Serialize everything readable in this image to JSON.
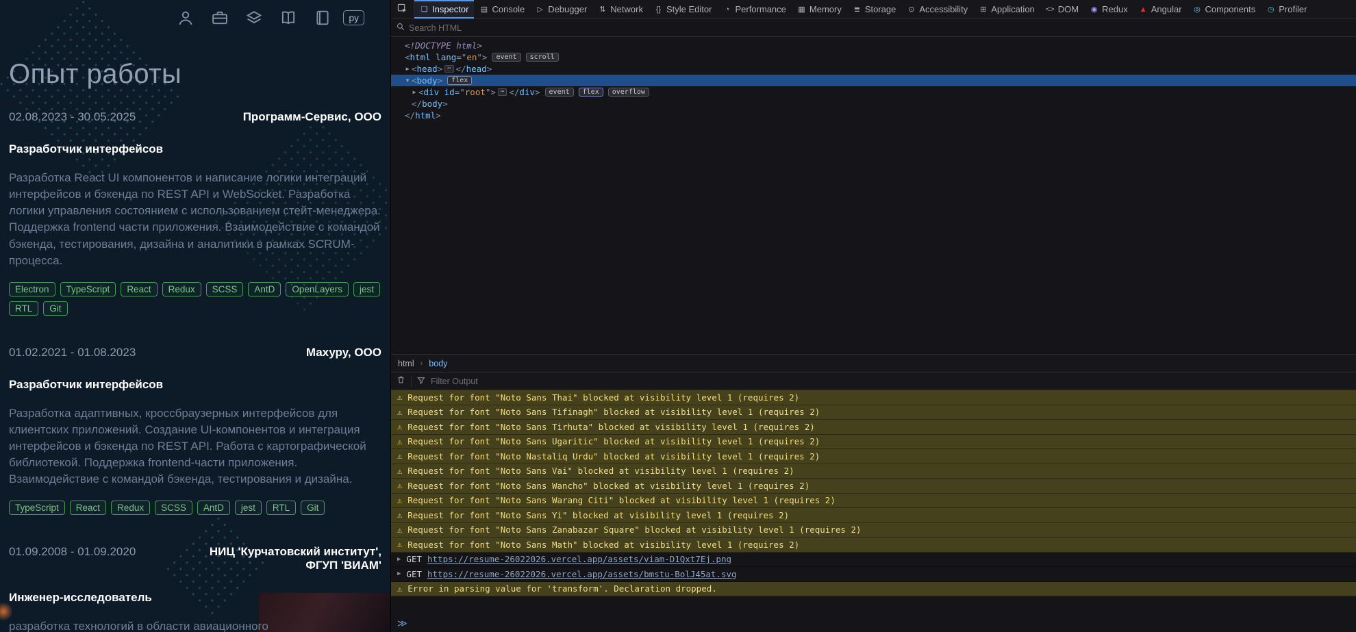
{
  "colors": {
    "site_bg": "#0d1a27",
    "tag_green_border": "#3f9d54",
    "devtools_selection": "#204e8a",
    "warning_bg": "#45411d",
    "warning_text": "#f2dd82",
    "markup_tag_blue": "#75bfff",
    "markup_value_orange": "#d2985f"
  },
  "site": {
    "header": {
      "icons": [
        "user-icon",
        "briefcase-icon",
        "layers-icon",
        "library-icon",
        "book-icon"
      ],
      "lang_label": "ру"
    },
    "page_title": "Опыт работы",
    "jobs": [
      {
        "period": "02.08.2023 - 30.05.2025",
        "company": "Программ-Сервис, ООО",
        "role": "Разработчик интерфейсов",
        "description": "Разработка React UI компонентов и написание логики интеграций интерфейсов и бэкенда по REST API и WebSocket. Разработка логики управления состоянием с использованием стейт-менеджера. Поддержка frontend части приложения. Взаимодействие с командой бэкенда, тестирования, дизайна и аналитики в рамках SCRUM-процесса.",
        "tags": [
          "Electron",
          "TypeScript",
          "React",
          "Redux",
          "SCSS",
          "AntD",
          "OpenLayers",
          "jest",
          "RTL",
          "Git"
        ]
      },
      {
        "period": "01.02.2021 - 01.08.2023",
        "company": "Махуру, ООО",
        "role": "Разработчик интерфейсов",
        "description": "Разработка адаптивных, кроссбраузерных интерфейсов для клиентских приложений. Создание UI-компонентов и интеграция интерфейсов и бэкенда по REST API. Работа с картографической библиотекой. Поддержка frontend-части приложения. Взаимодействие с командой бэкенда, тестирования и дизайна.",
        "tags": [
          "TypeScript",
          "React",
          "Redux",
          "SCSS",
          "AntD",
          "jest",
          "RTL",
          "Git"
        ]
      },
      {
        "period": "01.09.2008 - 01.09.2020",
        "company": "НИЦ 'Курчатовский институт',\nФГУП 'ВИАМ'",
        "role": "Инженер-исследователь",
        "description": "разработка технологий в области авиационного",
        "tags": []
      }
    ]
  },
  "devtools": {
    "tabs": [
      {
        "label": "Inspector",
        "icon": "inspector-icon",
        "selected": true
      },
      {
        "label": "Console",
        "icon": "console-icon",
        "selected": false
      },
      {
        "label": "Debugger",
        "icon": "debugger-icon",
        "selected": false
      },
      {
        "label": "Network",
        "icon": "network-icon",
        "selected": false
      },
      {
        "label": "Style Editor",
        "icon": "style-editor-icon",
        "selected": false
      },
      {
        "label": "Performance",
        "icon": "performance-icon",
        "selected": false
      },
      {
        "label": "Memory",
        "icon": "memory-icon",
        "selected": false
      },
      {
        "label": "Storage",
        "icon": "storage-icon",
        "selected": false
      },
      {
        "label": "Accessibility",
        "icon": "accessibility-icon",
        "selected": false
      },
      {
        "label": "Application",
        "icon": "application-icon",
        "selected": false
      },
      {
        "label": "DOM",
        "icon": "dom-icon",
        "selected": false
      },
      {
        "label": "Redux",
        "icon": "redux-icon",
        "selected": false
      },
      {
        "label": "Angular",
        "icon": "angular-icon",
        "selected": false
      },
      {
        "label": "Components",
        "icon": "components-icon",
        "selected": false
      },
      {
        "label": "Profiler",
        "icon": "profiler-icon",
        "selected": false
      }
    ],
    "search_placeholder": "Search HTML",
    "markup_lines": [
      {
        "indent": 0,
        "arrow": null,
        "selected": false,
        "tokens": [
          [
            "doctype",
            "<!DOCTYPE html>"
          ]
        ]
      },
      {
        "indent": 0,
        "arrow": null,
        "selected": false,
        "tokens": [
          [
            "punc",
            "<"
          ],
          [
            "tag",
            "html"
          ],
          [
            "punc",
            " "
          ],
          [
            "attr",
            "lang"
          ],
          [
            "punc",
            "=\""
          ],
          [
            "val",
            "en"
          ],
          [
            "punc",
            "\">"
          ],
          [
            "badge",
            "event"
          ],
          [
            "badge",
            "scroll"
          ]
        ]
      },
      {
        "indent": 1,
        "arrow": "collapsed",
        "selected": false,
        "tokens": [
          [
            "punc",
            "<"
          ],
          [
            "tag",
            "head"
          ],
          [
            "punc",
            ">"
          ],
          [
            "ellipsis",
            "⋯"
          ],
          [
            "punc",
            "</"
          ],
          [
            "tag",
            "head"
          ],
          [
            "punc",
            ">"
          ]
        ]
      },
      {
        "indent": 1,
        "arrow": "expanded",
        "selected": true,
        "tokens": [
          [
            "punc",
            "<"
          ],
          [
            "tag",
            "body"
          ],
          [
            "punc",
            ">"
          ],
          [
            "badgeflex",
            "flex"
          ]
        ]
      },
      {
        "indent": 2,
        "arrow": "collapsed",
        "selected": false,
        "tokens": [
          [
            "punc",
            "<"
          ],
          [
            "tag",
            "div"
          ],
          [
            "punc",
            " "
          ],
          [
            "attr",
            "id"
          ],
          [
            "punc",
            "=\""
          ],
          [
            "val",
            "root"
          ],
          [
            "punc",
            "\">"
          ],
          [
            "ellipsis",
            "⋯"
          ],
          [
            "punc",
            "</"
          ],
          [
            "tag",
            "div"
          ],
          [
            "punc",
            ">"
          ],
          [
            "badge",
            "event"
          ],
          [
            "badgeflex",
            "flex"
          ],
          [
            "badge",
            "overflow"
          ]
        ]
      },
      {
        "indent": 1,
        "arrow": null,
        "selected": false,
        "tokens": [
          [
            "punc",
            "</"
          ],
          [
            "tag",
            "body"
          ],
          [
            "punc",
            ">"
          ]
        ]
      },
      {
        "indent": 0,
        "arrow": null,
        "selected": false,
        "tokens": [
          [
            "punc",
            "</"
          ],
          [
            "tag",
            "html"
          ],
          [
            "punc",
            ">"
          ]
        ]
      }
    ],
    "breadcrumbs": [
      {
        "label": "html",
        "selected": false
      },
      {
        "label": "body",
        "selected": true
      }
    ],
    "console": {
      "filter_placeholder": "Filter Output",
      "prompt": "≫",
      "rows": [
        {
          "type": "warn",
          "text": "Request for font \"Noto Sans Thai\" blocked at visibility level 1 (requires 2)"
        },
        {
          "type": "warn",
          "text": "Request for font \"Noto Sans Tifinagh\" blocked at visibility level 1 (requires 2)"
        },
        {
          "type": "warn",
          "text": "Request for font \"Noto Sans Tirhuta\" blocked at visibility level 1 (requires 2)"
        },
        {
          "type": "warn",
          "text": "Request for font \"Noto Sans Ugaritic\" blocked at visibility level 1 (requires 2)"
        },
        {
          "type": "warn",
          "text": "Request for font \"Noto Nastaliq Urdu\" blocked at visibility level 1 (requires 2)"
        },
        {
          "type": "warn",
          "text": "Request for font \"Noto Sans Vai\" blocked at visibility level 1 (requires 2)"
        },
        {
          "type": "warn",
          "text": "Request for font \"Noto Sans Wancho\" blocked at visibility level 1 (requires 2)"
        },
        {
          "type": "warn",
          "text": "Request for font \"Noto Sans Warang Citi\" blocked at visibility level 1 (requires 2)"
        },
        {
          "type": "warn",
          "text": "Request for font \"Noto Sans Yi\" blocked at visibility level 1 (requires 2)"
        },
        {
          "type": "warn",
          "text": "Request for font \"Noto Sans Zanabazar Square\" blocked at visibility level 1 (requires 2)"
        },
        {
          "type": "warn",
          "text": "Request for font \"Noto Sans Math\" blocked at visibility level 1 (requires 2)"
        },
        {
          "type": "get",
          "method": "GET",
          "url": "https://resume-26022026.vercel.app/assets/viam-D1Qxt7Ej.png"
        },
        {
          "type": "get",
          "method": "GET",
          "url": "https://resume-26022026.vercel.app/assets/bmstu-BolJ45at.svg"
        },
        {
          "type": "warn",
          "text": "Error in parsing value for 'transform'.  Declaration dropped."
        }
      ]
    }
  }
}
